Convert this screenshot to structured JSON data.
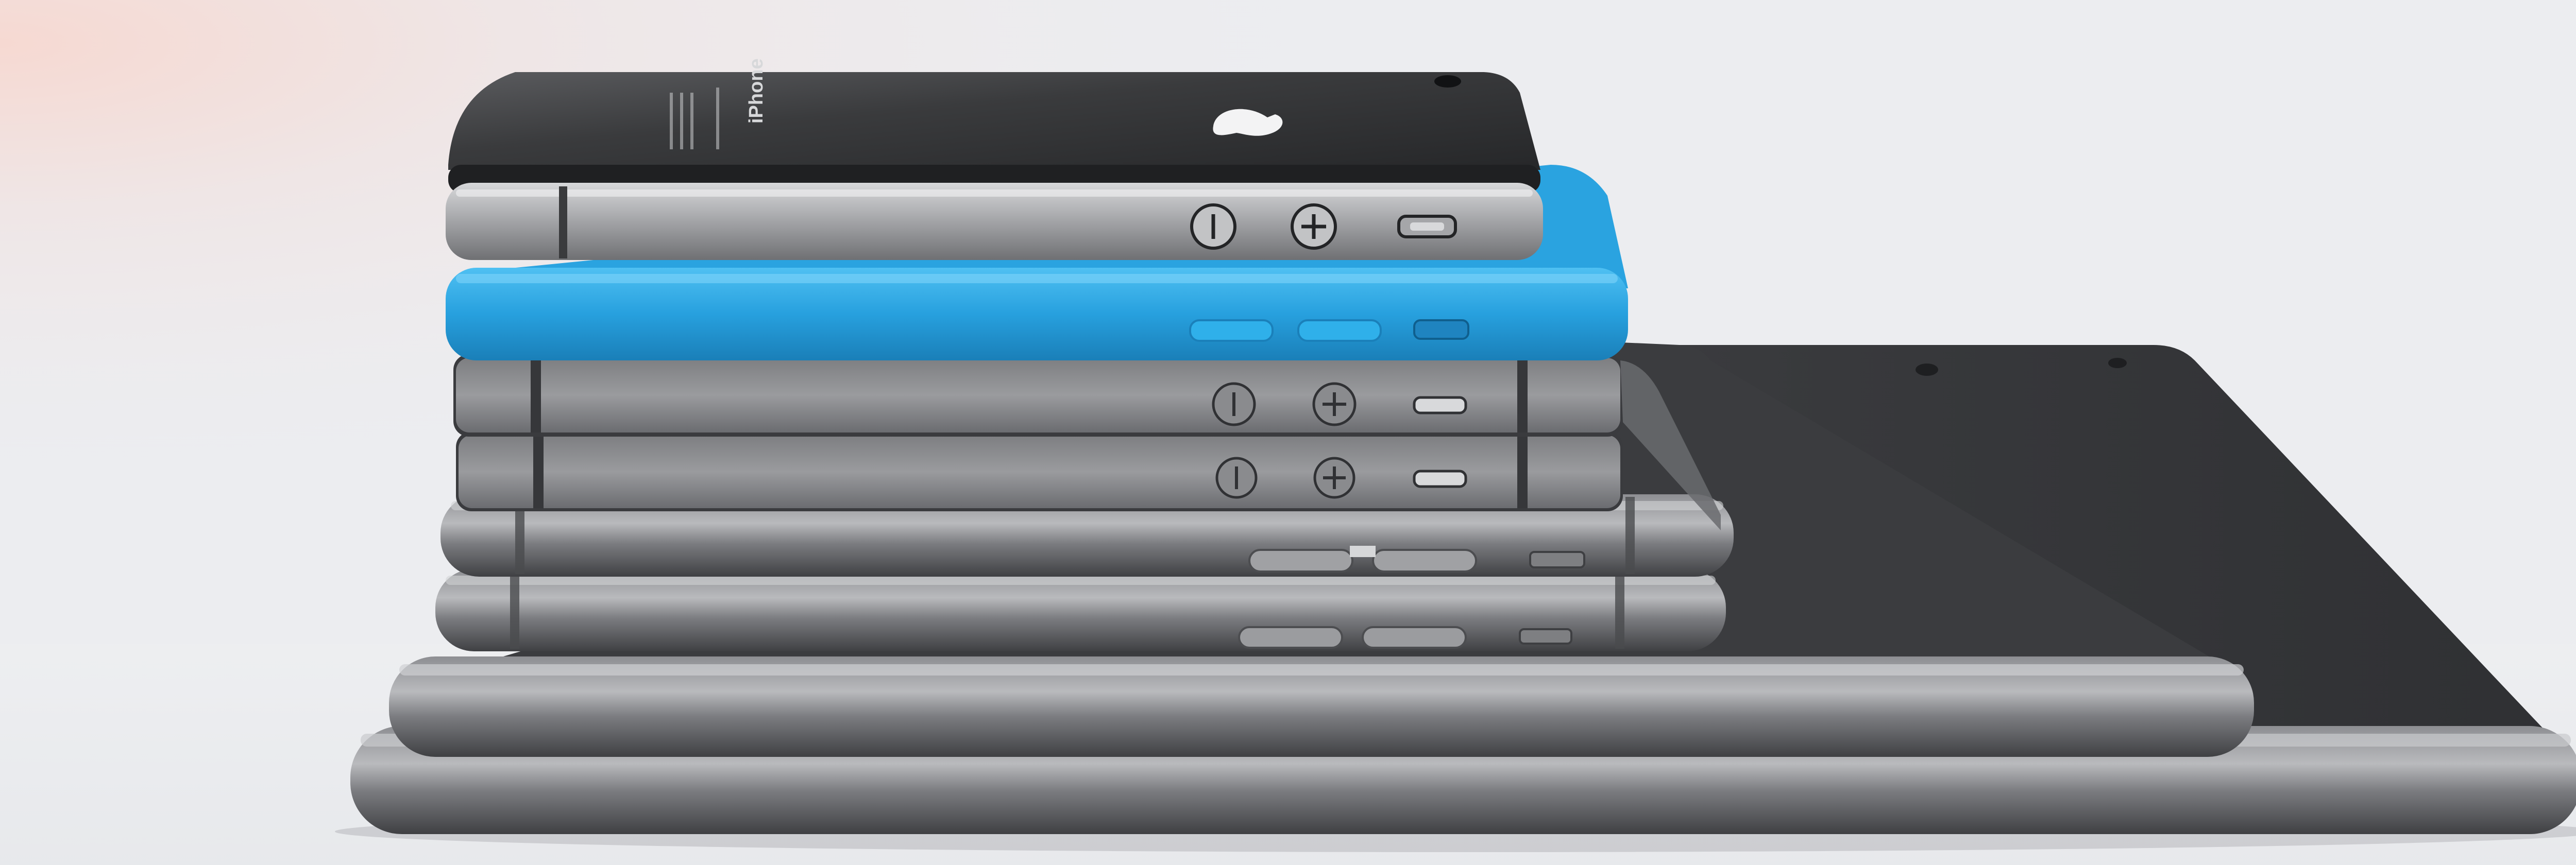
{
  "scene": {
    "devices": [
      {
        "model": "ipad-large",
        "finish": "space-gray",
        "color": "#3a3b3e"
      },
      {
        "model": "ipad-mini",
        "finish": "space-gray",
        "color": "#3b3c3f"
      },
      {
        "model": "iphone-6",
        "finish": "space-gray",
        "color": "#5c5d61"
      },
      {
        "model": "iphone-6",
        "finish": "space-gray",
        "color": "#606165"
      },
      {
        "model": "iphone-5s",
        "finish": "space-gray",
        "color": "#58595c"
      },
      {
        "model": "iphone-5s",
        "finish": "space-gray",
        "color": "#58595c"
      },
      {
        "model": "iphone-5c",
        "finish": "blue",
        "color": "#2aa3e0"
      },
      {
        "model": "iphone-4s",
        "finish": "black-steel",
        "color": "#2d2e30"
      }
    ],
    "brand_lettering": "iPhone",
    "logo_icon": "apple-logo-icon",
    "background_color": "#ecedf0"
  }
}
